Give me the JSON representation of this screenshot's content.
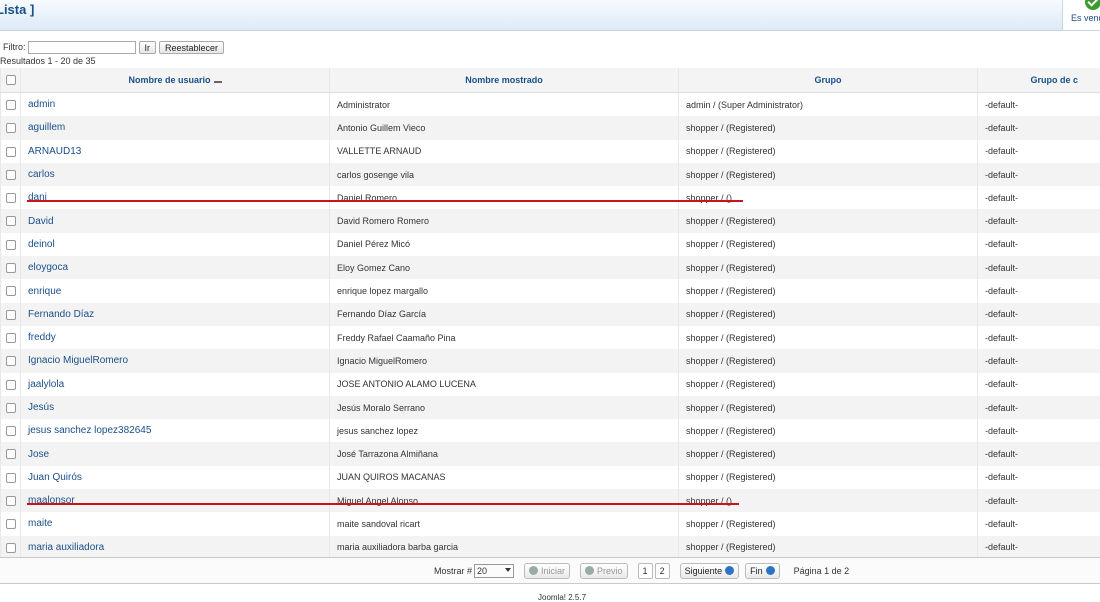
{
  "header": {
    "title": "Lista ]",
    "right_label": "Es vend"
  },
  "filter": {
    "label": "Filtro:",
    "value": "",
    "go_label": "Ir",
    "reset_label": "Reestablecer"
  },
  "results_info": "Resultados 1 - 20 de 35",
  "columns": [
    "Nombre de usuario",
    "Nombre mostrado",
    "Grupo",
    "Grupo de c"
  ],
  "rows": [
    {
      "username": "admin",
      "display": "Administrator",
      "group": "admin / (Super Administrator)",
      "shop_group": "-default-"
    },
    {
      "username": "aguillem",
      "display": "Antonio Guillem Vieco",
      "group": "shopper / (Registered)",
      "shop_group": "-default-"
    },
    {
      "username": "ARNAUD13",
      "display": "VALLETTE ARNAUD",
      "group": "shopper / (Registered)",
      "shop_group": "-default-"
    },
    {
      "username": "carlos",
      "display": "carlos gosenge vila",
      "group": "shopper / (Registered)",
      "shop_group": "-default-"
    },
    {
      "username": "dani",
      "display": "Daniel Romero",
      "group": "shopper / ()",
      "shop_group": "-default-"
    },
    {
      "username": "David",
      "display": "David Romero Romero",
      "group": "shopper / (Registered)",
      "shop_group": "-default-"
    },
    {
      "username": "deinol",
      "display": "Daniel Pérez Micó",
      "group": "shopper / (Registered)",
      "shop_group": "-default-"
    },
    {
      "username": "eloygoca",
      "display": "Eloy Gomez Cano",
      "group": "shopper / (Registered)",
      "shop_group": "-default-"
    },
    {
      "username": "enrique",
      "display": "enrique lopez margallo",
      "group": "shopper / (Registered)",
      "shop_group": "-default-"
    },
    {
      "username": "Fernando Díaz",
      "display": "Fernando Díaz García",
      "group": "shopper / (Registered)",
      "shop_group": "-default-"
    },
    {
      "username": "freddy",
      "display": "Freddy Rafael Caamaño Pina",
      "group": "shopper / (Registered)",
      "shop_group": "-default-"
    },
    {
      "username": "Ignacio MiguelRomero",
      "display": "Ignacio MiguelRomero",
      "group": "shopper / (Registered)",
      "shop_group": "-default-"
    },
    {
      "username": "jaalylola",
      "display": "JOSE ANTONIO ALAMO LUCENA",
      "group": "shopper / (Registered)",
      "shop_group": "-default-"
    },
    {
      "username": "Jesús",
      "display": "Jesús Moralo Serrano",
      "group": "shopper / (Registered)",
      "shop_group": "-default-"
    },
    {
      "username": "jesus sanchez lopez382645",
      "display": "jesus sanchez lopez",
      "group": "shopper / (Registered)",
      "shop_group": "-default-"
    },
    {
      "username": "Jose",
      "display": "José Tarrazona Almiñana",
      "group": "shopper / (Registered)",
      "shop_group": "-default-"
    },
    {
      "username": "Juan Quirós",
      "display": "JUAN QUIROS MACANAS",
      "group": "shopper / (Registered)",
      "shop_group": "-default-"
    },
    {
      "username": "maalonsor",
      "display": "Miguel Angel Alonso",
      "group": "shopper / ()",
      "shop_group": "-default-"
    },
    {
      "username": "maite",
      "display": "maite sandoval ricart",
      "group": "shopper / (Registered)",
      "shop_group": "-default-"
    },
    {
      "username": "maria auxiliadora",
      "display": "maria auxiliadora barba garcia",
      "group": "shopper / (Registered)",
      "shop_group": "-default-"
    }
  ],
  "pagination": {
    "show_label": "Mostrar #",
    "show_value": "20",
    "start_label": "Iniciar",
    "prev_label": "Previo",
    "pages": [
      "1",
      "2"
    ],
    "next_label": "Siguiente",
    "end_label": "Fin",
    "page_info": "Página 1 de 2"
  },
  "footer_version": "Joomla! 2.5.7",
  "colors": {
    "link": "#1a4f8a",
    "highlight_line": "#c9141b"
  },
  "icons": {
    "check": "check-circle-icon",
    "sort": "sort-ascending-icon",
    "prev": "arrow-left-icon",
    "next": "arrow-right-icon"
  }
}
